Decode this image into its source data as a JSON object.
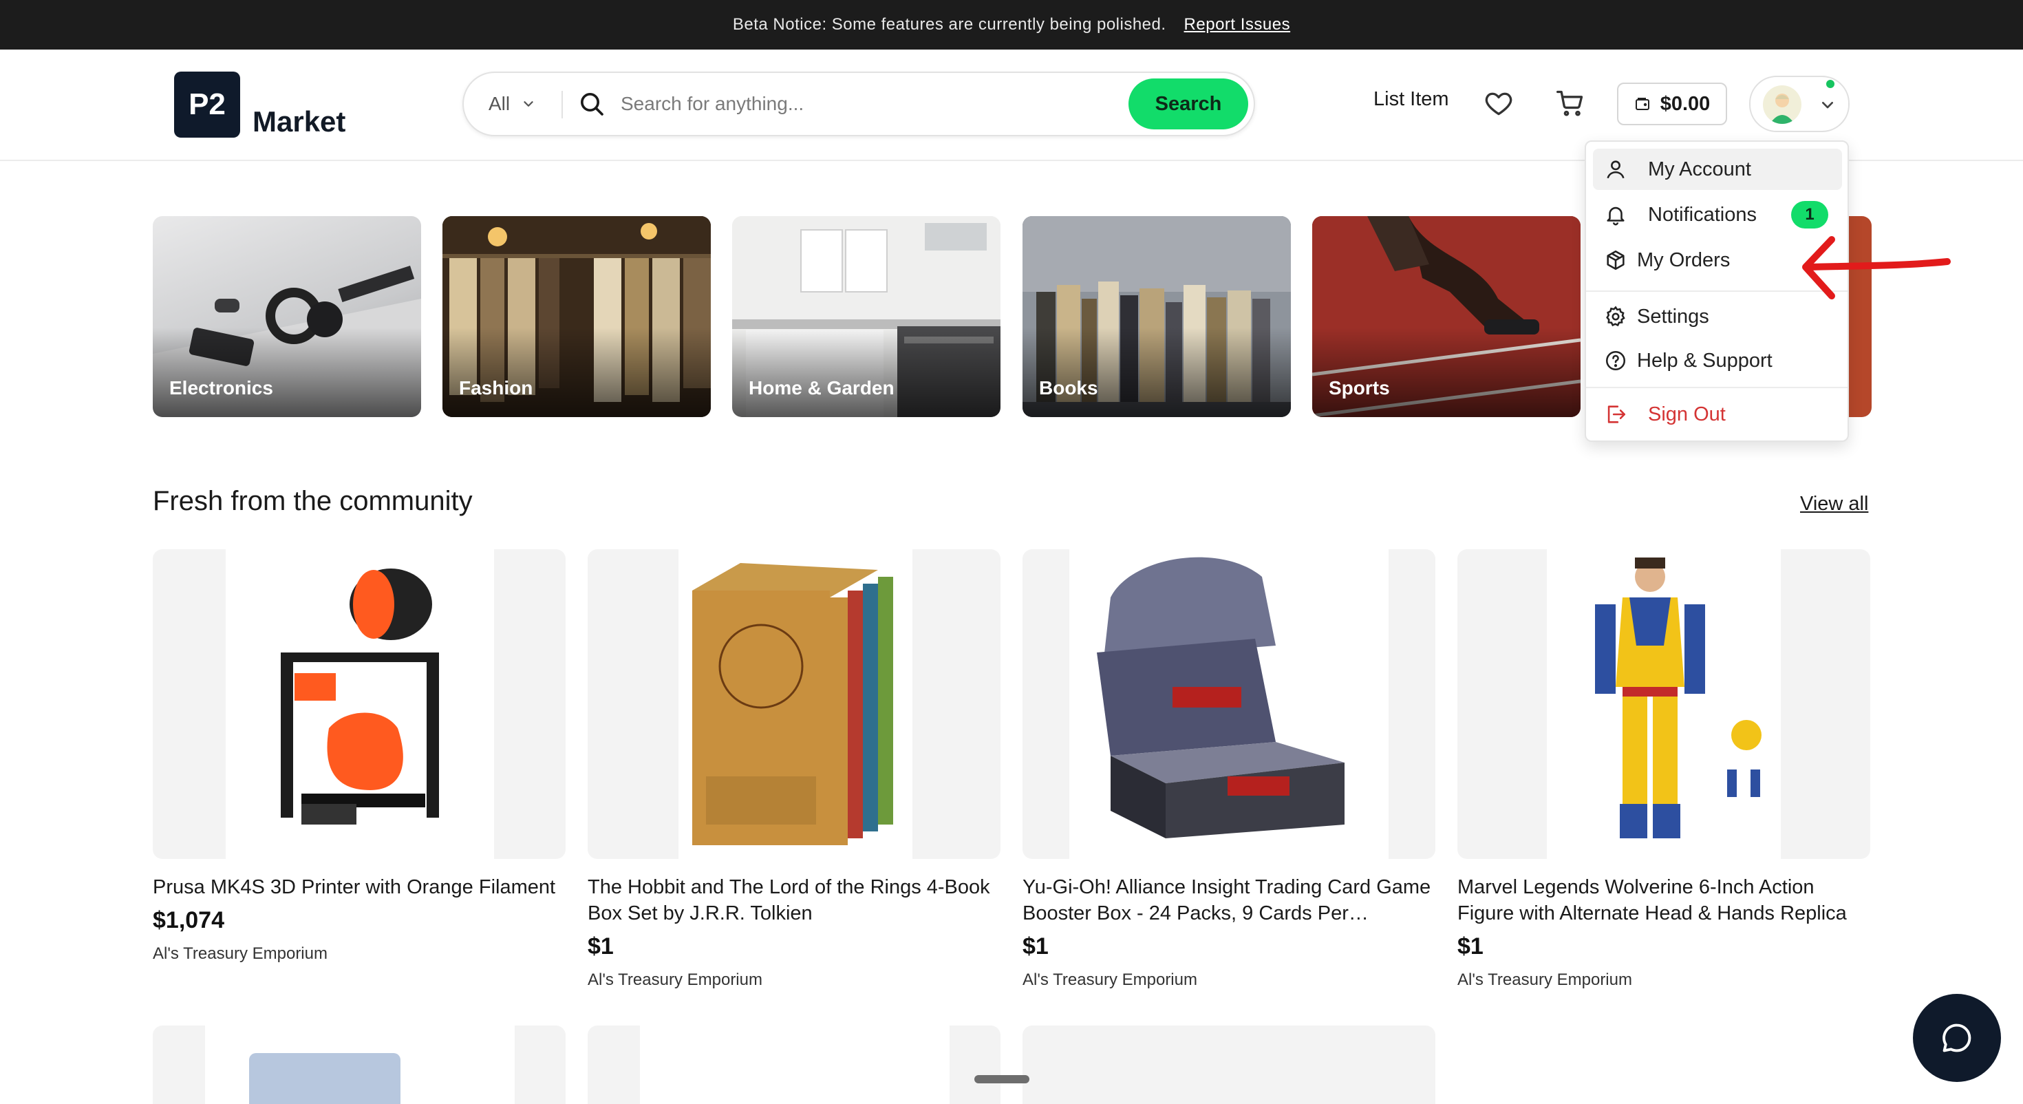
{
  "banner": {
    "text": "Beta Notice: Some features are currently being polished.",
    "link": "Report Issues"
  },
  "header": {
    "logo_badge": "P2",
    "logo_text": "Market",
    "search_category": "All",
    "search_placeholder": "Search for anything...",
    "search_button": "Search",
    "list_item": "List Item",
    "wallet_balance": "$0.00",
    "colors": {
      "accent": "#12dc6a",
      "dark": "#0f1a2b",
      "danger": "#d43434"
    }
  },
  "account_menu": {
    "items": [
      {
        "label": "My Account",
        "icon": "user-icon"
      },
      {
        "label": "Notifications",
        "icon": "bell-icon",
        "badge": "1"
      },
      {
        "label": "My Orders",
        "icon": "package-icon"
      },
      {
        "label": "Settings",
        "icon": "gear-icon"
      },
      {
        "label": "Help & Support",
        "icon": "help-icon"
      },
      {
        "label": "Sign Out",
        "icon": "sign-out-icon"
      }
    ]
  },
  "categories": [
    {
      "label": "Electronics"
    },
    {
      "label": "Fashion"
    },
    {
      "label": "Home & Garden"
    },
    {
      "label": "Books"
    },
    {
      "label": "Sports"
    }
  ],
  "section": {
    "title": "Fresh from the community",
    "view_all": "View all"
  },
  "products": [
    {
      "title": "Prusa MK4S 3D Printer with Orange Filament",
      "price": "$1,074",
      "seller": "Al's Treasury Emporium"
    },
    {
      "title": "The Hobbit and The Lord of the Rings 4-Book Box Set by J.R.R. Tolkien",
      "price": "$1",
      "seller": "Al's Treasury Emporium"
    },
    {
      "title": "Yu-Gi-Oh! Alliance Insight Trading Card Game Booster Box - 24 Packs, 9 Cards Per…",
      "price": "$1",
      "seller": "Al's Treasury Emporium"
    },
    {
      "title": "Marvel Legends Wolverine 6-Inch Action Figure with Alternate Head & Hands Replica",
      "price": "$1",
      "seller": "Al's Treasury Emporium"
    }
  ]
}
